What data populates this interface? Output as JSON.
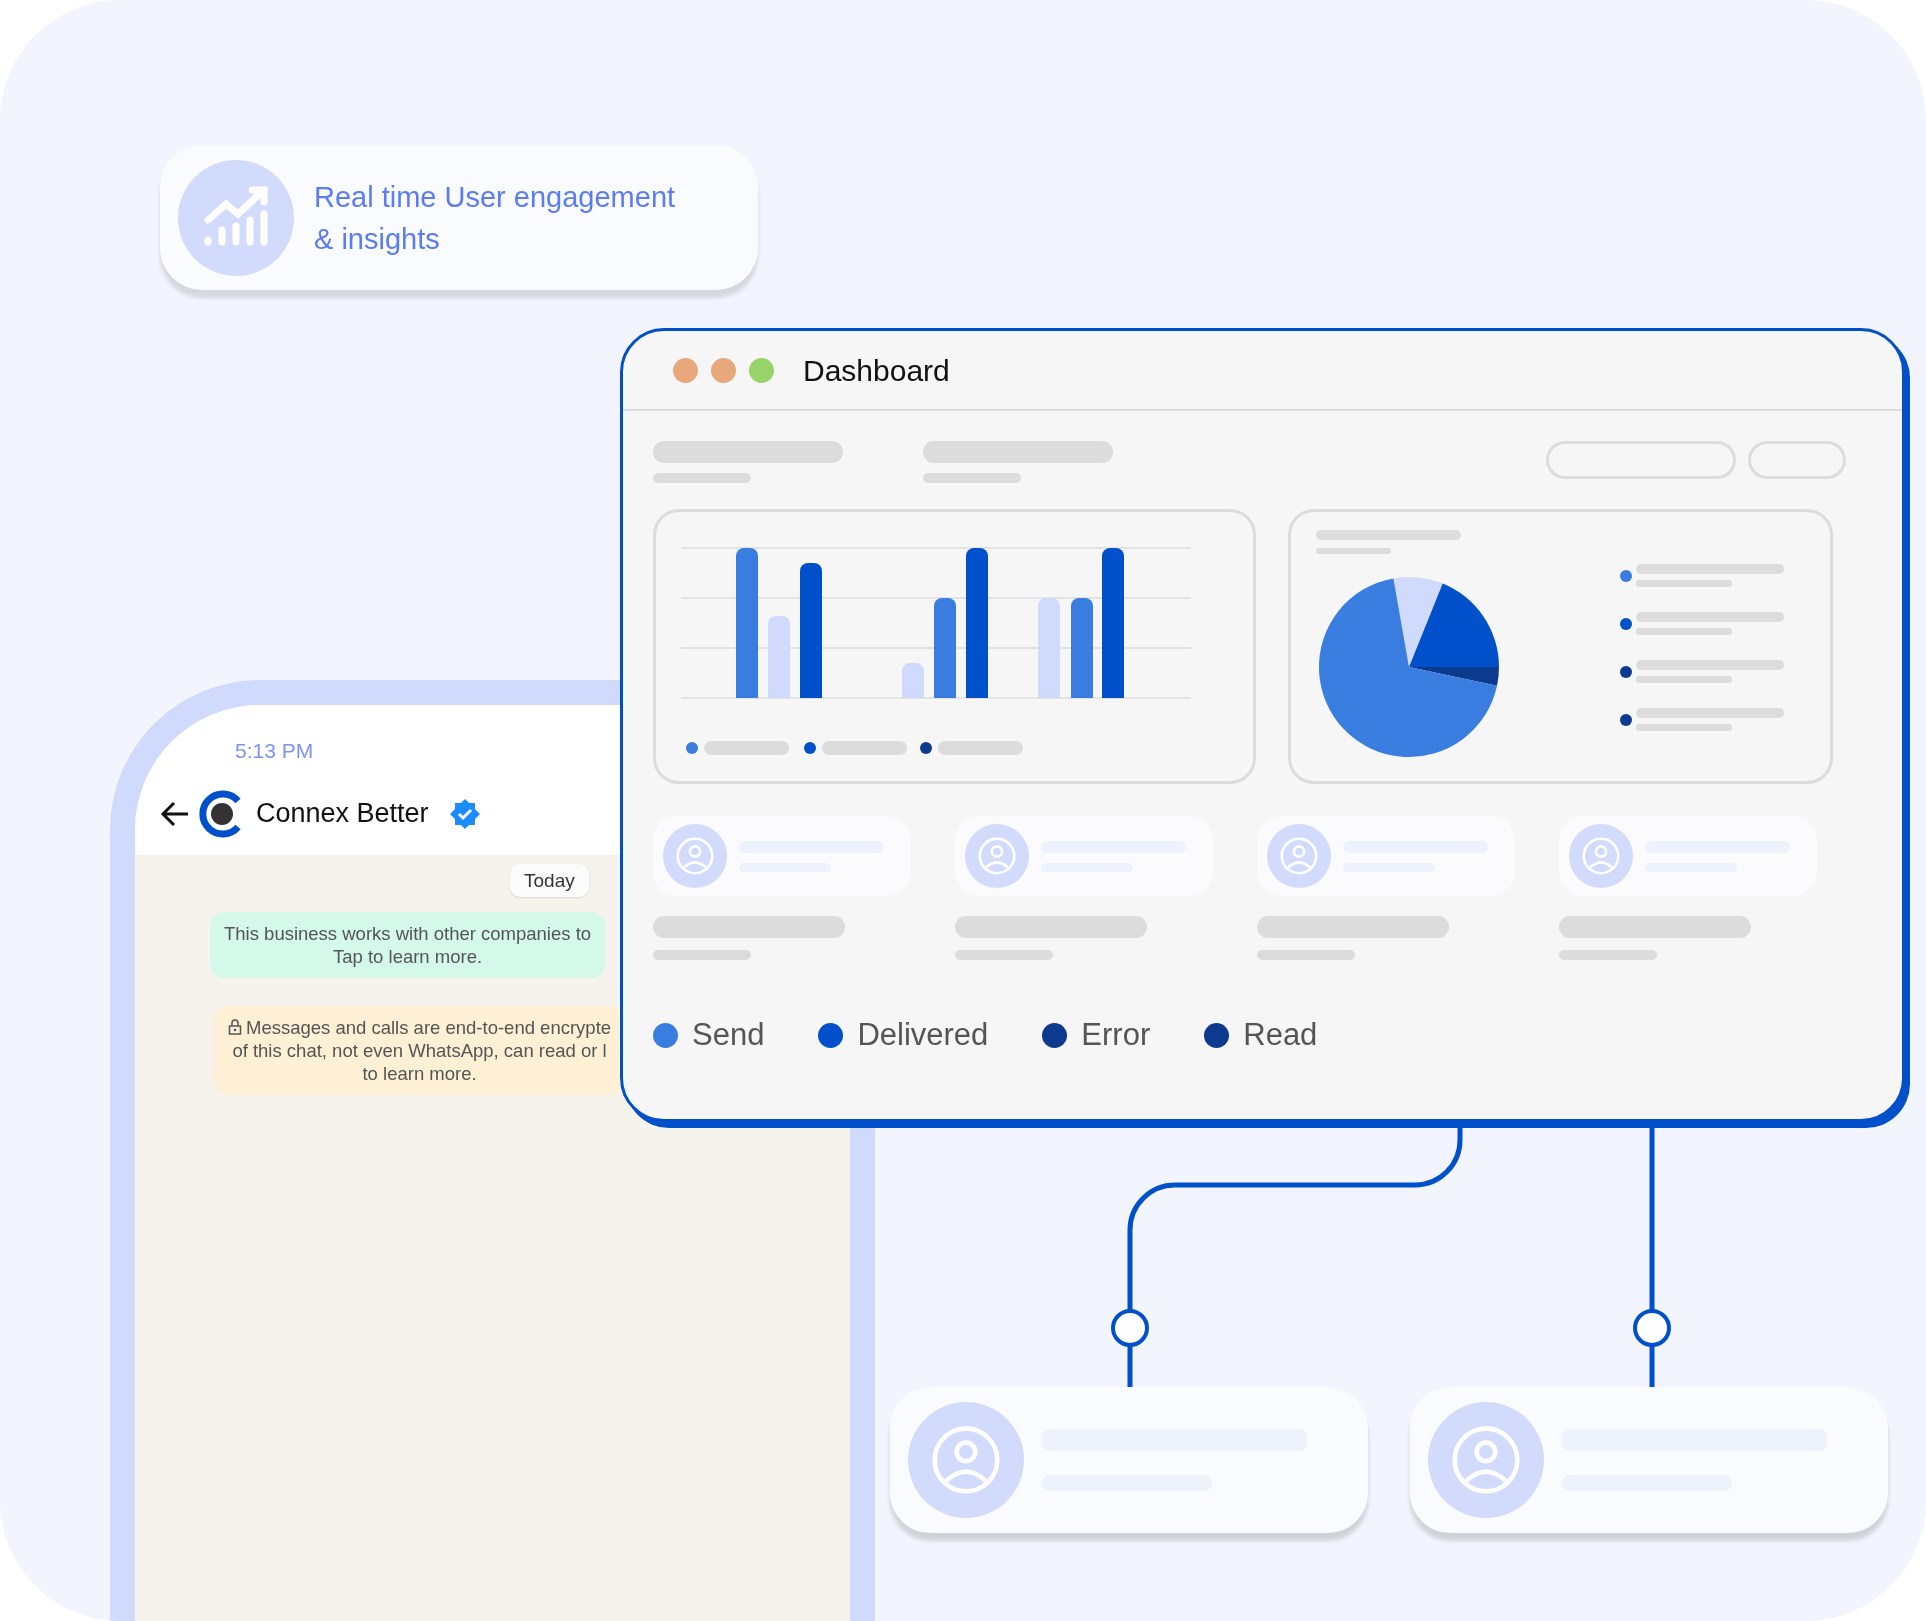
{
  "insight": {
    "text": "Real time User engagement & insights"
  },
  "phone": {
    "time": "5:13 PM",
    "contact_name": "Connex Better",
    "date_chip": "Today",
    "messages": [
      {
        "kind": "business",
        "lines": [
          "This business works with other companies to",
          "Tap to learn more."
        ]
      },
      {
        "kind": "encryption",
        "lines": [
          "Messages and calls are end-to-end encrypte",
          "of this chat, not even WhatsApp, can read or l",
          "to learn more."
        ]
      }
    ]
  },
  "dashboard": {
    "title": "Dashboard",
    "legend": [
      {
        "label": "Send",
        "color": "#3a7de0"
      },
      {
        "label": "Delivered",
        "color": "#0050cc"
      },
      {
        "label": "Error",
        "color": "#0b3a8e"
      },
      {
        "label": "Read",
        "color": "#0b3a8e"
      }
    ]
  }
}
